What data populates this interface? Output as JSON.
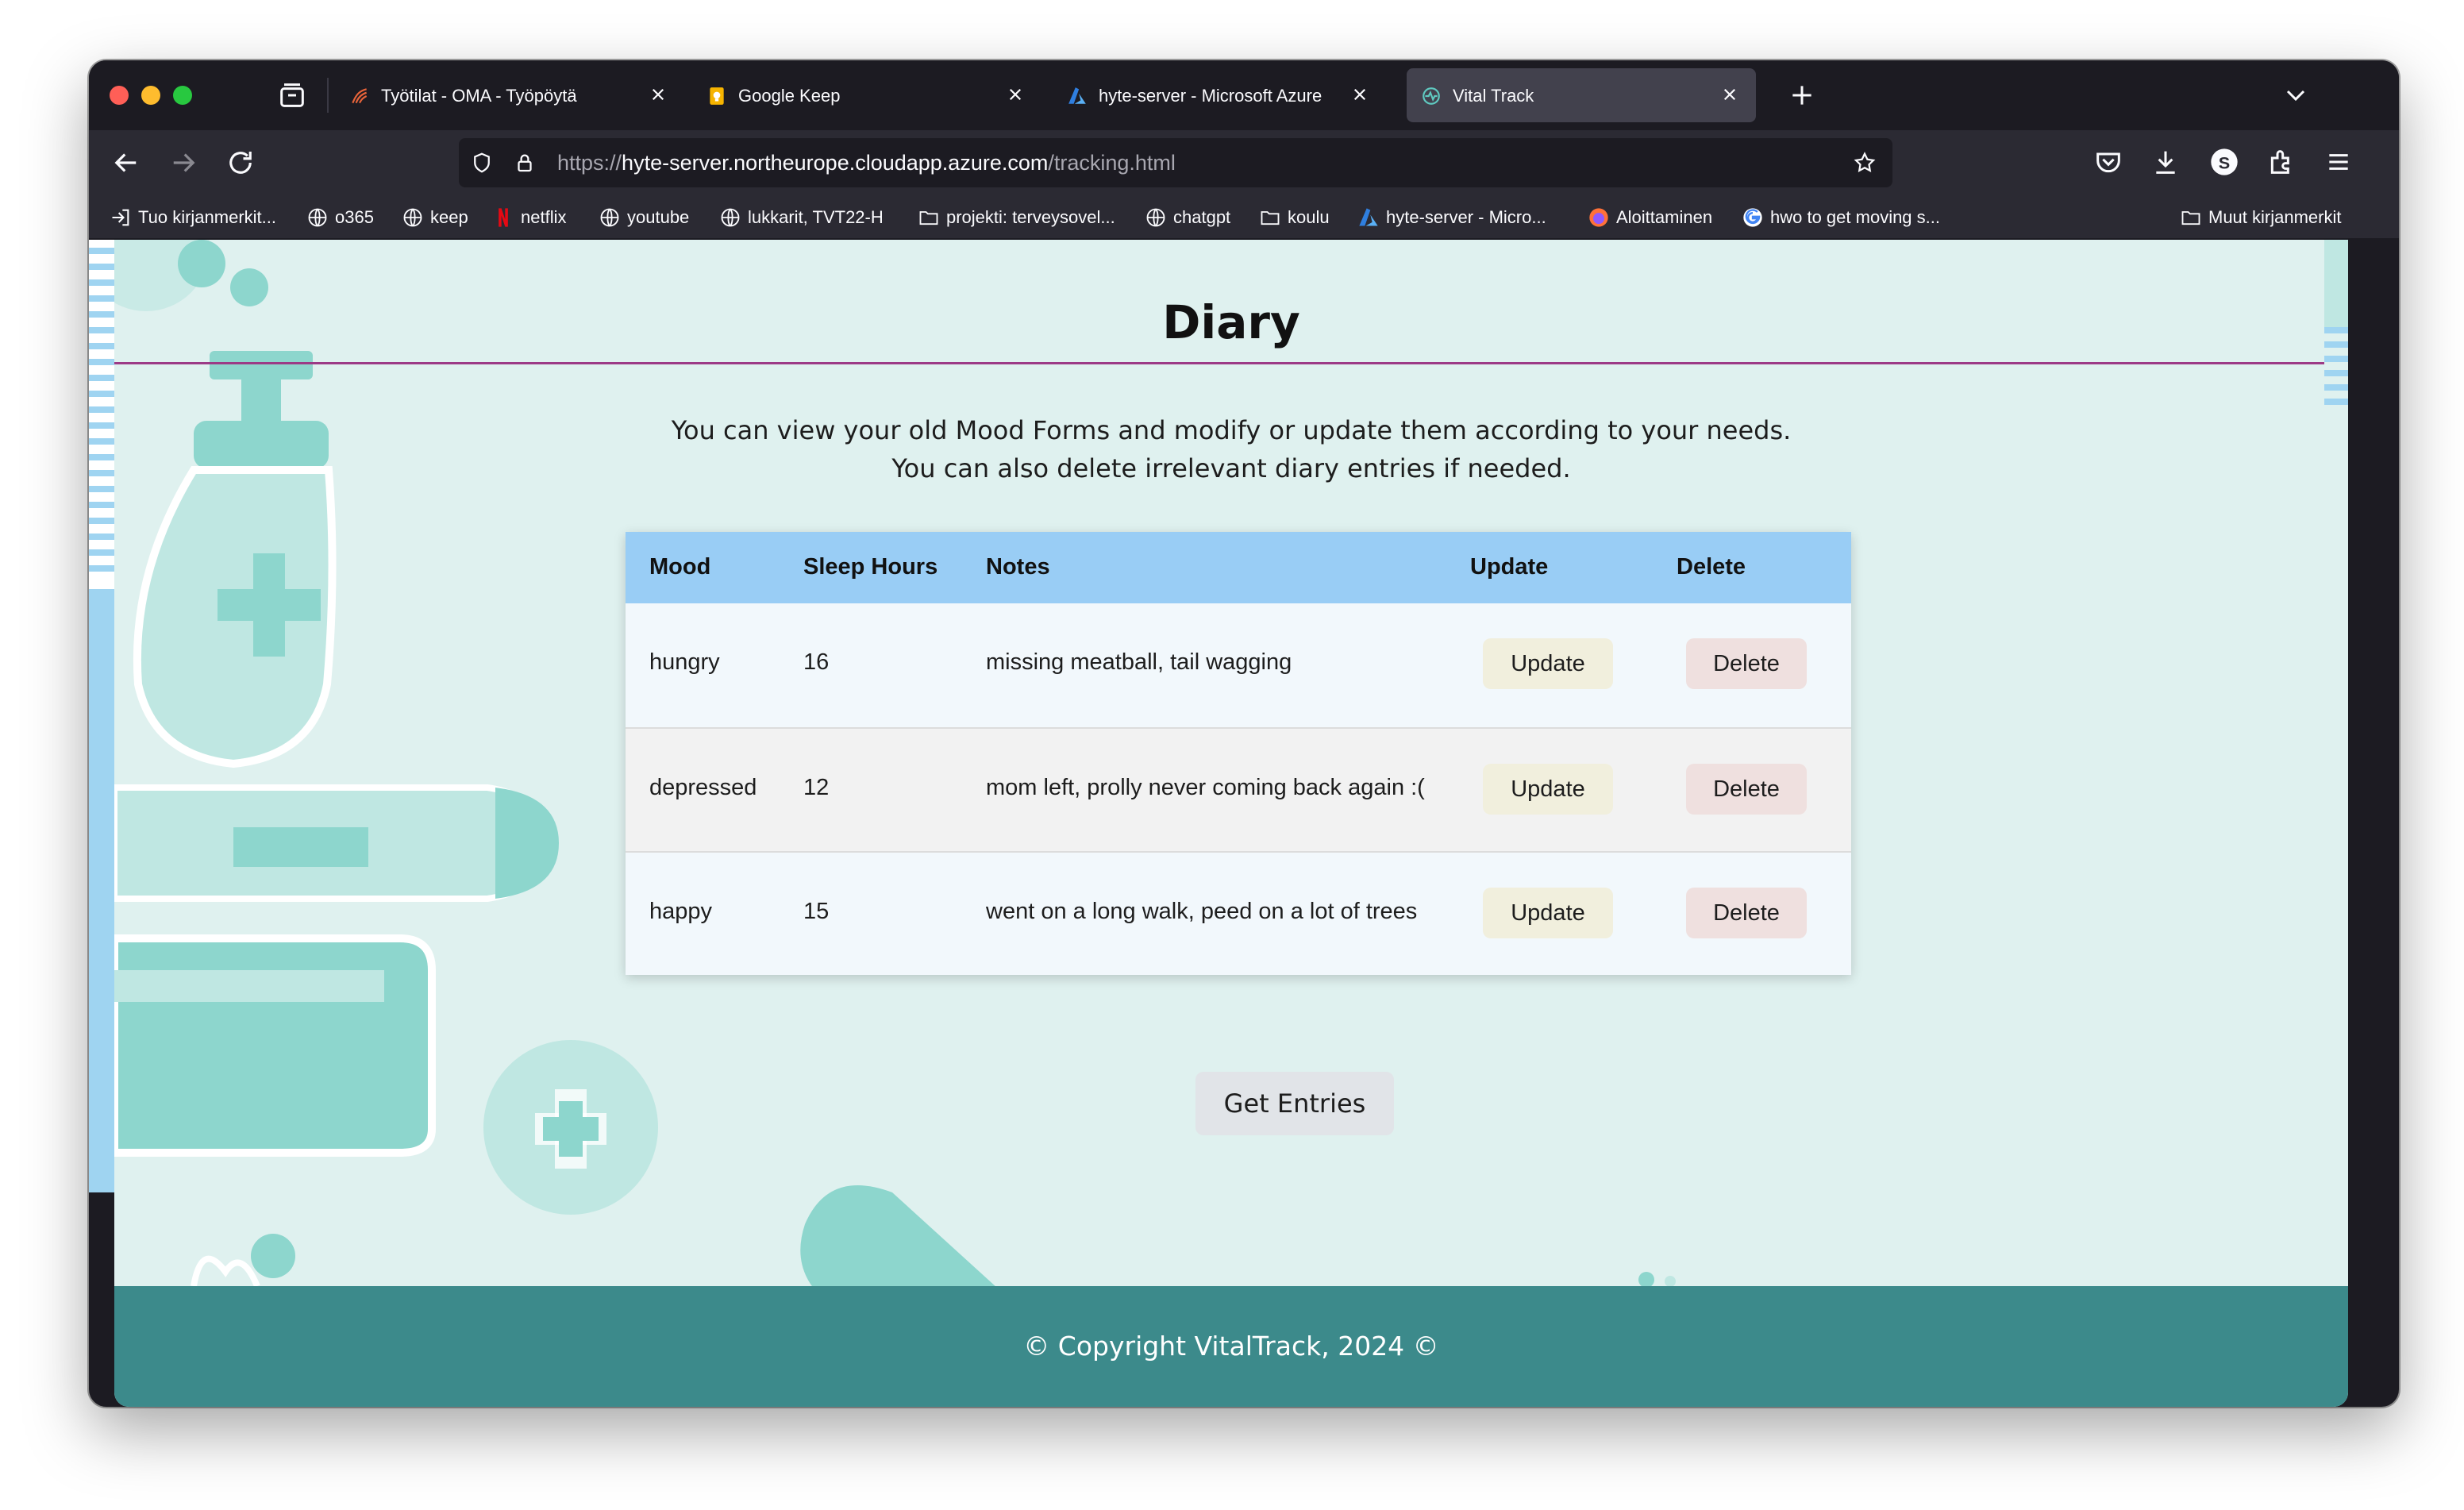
{
  "browser": {
    "tabs": [
      {
        "label": "Työtilat - OMA - Työpöytä",
        "active": false
      },
      {
        "label": "Google Keep",
        "active": false
      },
      {
        "label": "hyte-server - Microsoft Azure",
        "active": false
      },
      {
        "label": "Vital Track",
        "active": true
      }
    ],
    "url": {
      "scheme": "https://",
      "host": "hyte-server.northeurope.cloudapp.azure.com",
      "path": "/tracking.html"
    },
    "bookmarks": [
      {
        "label": "Tuo kirjanmerkit...",
        "icon": "import-icon"
      },
      {
        "label": "o365",
        "icon": "globe-icon"
      },
      {
        "label": "keep",
        "icon": "globe-icon"
      },
      {
        "label": "netflix",
        "icon": "netflix-icon"
      },
      {
        "label": "youtube",
        "icon": "globe-icon"
      },
      {
        "label": "lukkarit, TVT22-H",
        "icon": "globe-icon"
      },
      {
        "label": "projekti: terveysovel...",
        "icon": "folder-icon"
      },
      {
        "label": "chatgpt",
        "icon": "globe-icon"
      },
      {
        "label": "koulu",
        "icon": "folder-icon"
      },
      {
        "label": "hyte-server - Micro...",
        "icon": "azure-icon"
      },
      {
        "label": "Aloittaminen",
        "icon": "firefox-icon"
      },
      {
        "label": "hwo to get moving s...",
        "icon": "google-icon"
      }
    ],
    "other_bookmarks": "Muut kirjanmerkit"
  },
  "page": {
    "title": "Diary",
    "intro_line1": "You can view your old Mood Forms and modify or update them according to your needs.",
    "intro_line2": "You can also delete irrelevant diary entries if needed.",
    "table": {
      "headers": [
        "Mood",
        "Sleep Hours",
        "Notes",
        "Update",
        "Delete"
      ],
      "rows": [
        {
          "mood": "hungry",
          "sleep": "16",
          "notes": "missing meatball, tail wagging"
        },
        {
          "mood": "depressed",
          "sleep": "12",
          "notes": "mom left, prolly never coming back again :("
        },
        {
          "mood": "happy",
          "sleep": "15",
          "notes": "went on a long walk, peed on a lot of trees"
        }
      ],
      "update_label": "Update",
      "delete_label": "Delete"
    },
    "get_entries_label": "Get Entries",
    "footer": "© Copyright VitalTrack, 2024 ©"
  },
  "colors": {
    "page_bg": "#dff1ef",
    "table_header": "#99cdf5",
    "footer": "#3c8a8b",
    "title_rule": "#9c3a86",
    "decor_teal": "#8dd6cd"
  }
}
